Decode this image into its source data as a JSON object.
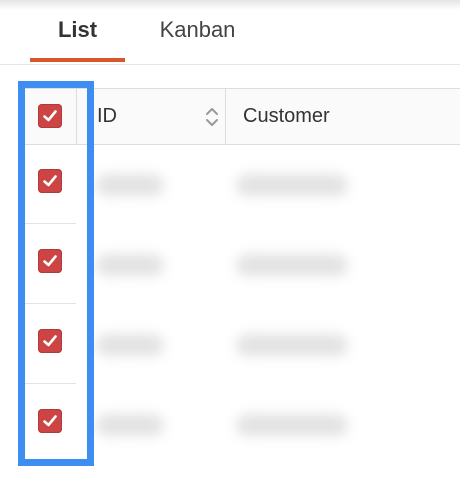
{
  "tabs": [
    {
      "label": "List",
      "active": true
    },
    {
      "label": "Kanban",
      "active": false
    }
  ],
  "table": {
    "columns": [
      "ID",
      "Customer"
    ],
    "select_all_checked": true,
    "rows": [
      {
        "checked": true
      },
      {
        "checked": true
      },
      {
        "checked": true
      },
      {
        "checked": true
      }
    ]
  },
  "icons": {
    "checkbox": "checkmark-icon",
    "sort": "sort-icon"
  },
  "colors": {
    "tab_underline": "#d9572b",
    "checkbox": "#cc4444",
    "highlight": "#3d8ef0"
  }
}
